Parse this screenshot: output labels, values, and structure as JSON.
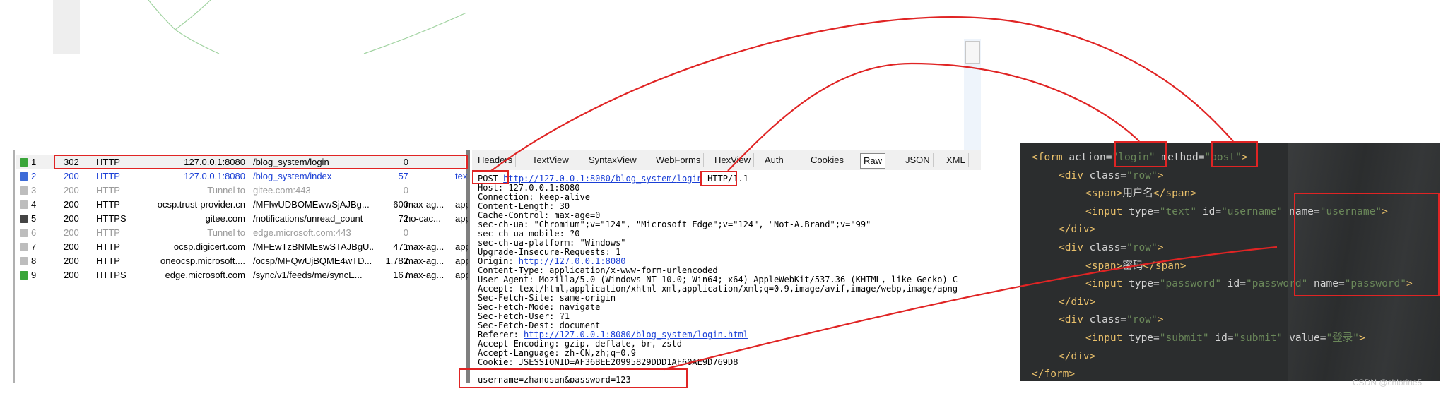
{
  "session_list": {
    "rows": [
      {
        "num": "1",
        "result": "302",
        "protocol": "HTTP",
        "host": "127.0.0.1:8080",
        "url": "/blog_system/login",
        "body": "0",
        "caching": "",
        "content_type": "",
        "icon": "arrow-right-green-icon",
        "style": "sel"
      },
      {
        "num": "2",
        "result": "200",
        "protocol": "HTTP",
        "host": "127.0.0.1:8080",
        "url": "/blog_system/index",
        "body": "57",
        "caching": "",
        "content_type": "tex",
        "icon": "bidirectional-arrow-icon",
        "style": "blue"
      },
      {
        "num": "3",
        "result": "200",
        "protocol": "HTTP",
        "host": "Tunnel to",
        "url": "gitee.com:443",
        "body": "0",
        "caching": "",
        "content_type": "",
        "icon": "lock-icon",
        "style": "gray"
      },
      {
        "num": "4",
        "result": "200",
        "protocol": "HTTP",
        "host": "ocsp.trust-provider.cn",
        "url": "/MFIwUDBOMEwwSjAJBg...",
        "body": "600",
        "caching": "max-ag...",
        "content_type": "app",
        "icon": "document-icon",
        "style": ""
      },
      {
        "num": "5",
        "result": "200",
        "protocol": "HTTPS",
        "host": "gitee.com",
        "url": "/notifications/unread_count",
        "body": "72",
        "caching": "no-cac...",
        "content_type": "app",
        "icon": "json-braces-icon",
        "style": ""
      },
      {
        "num": "6",
        "result": "200",
        "protocol": "HTTP",
        "host": "Tunnel to",
        "url": "edge.microsoft.com:443",
        "body": "0",
        "caching": "",
        "content_type": "",
        "icon": "lock-icon",
        "style": "gray"
      },
      {
        "num": "7",
        "result": "200",
        "protocol": "HTTP",
        "host": "ocsp.digicert.com",
        "url": "/MFEwTzBNMEswSTAJBgU...",
        "body": "471",
        "caching": "max-ag...",
        "content_type": "app",
        "icon": "document-icon",
        "style": ""
      },
      {
        "num": "8",
        "result": "200",
        "protocol": "HTTP",
        "host": "oneocsp.microsoft....",
        "url": "/ocsp/MFQwUjBQME4wTD...",
        "body": "1,782",
        "caching": "max-ag...",
        "content_type": "app",
        "icon": "document-icon",
        "style": ""
      },
      {
        "num": "9",
        "result": "200",
        "protocol": "HTTPS",
        "host": "edge.microsoft.com",
        "url": "/sync/v1/feeds/me/syncE...",
        "body": "167",
        "caching": "max-ag...",
        "content_type": "app",
        "icon": "arrow-right-green-icon",
        "style": ""
      }
    ]
  },
  "inspector": {
    "tabs": [
      "Headers",
      "TextView",
      "SyntaxView",
      "WebForms",
      "HexView",
      "Auth",
      "Cookies",
      "Raw",
      "JSON",
      "XML"
    ],
    "active_tab": "Raw",
    "request_line": {
      "method": "POST",
      "url_prefix": "http://127.0.0.1:8080/blog_system/",
      "url_login": "login",
      "version": " HTTP/1.1"
    },
    "headers": [
      "Host: 127.0.0.1:8080",
      "Connection: keep-alive",
      "Content-Length: 30",
      "Cache-Control: max-age=0",
      "sec-ch-ua: \"Chromium\";v=\"124\", \"Microsoft Edge\";v=\"124\", \"Not-A.Brand\";v=\"99\"",
      "sec-ch-ua-mobile: ?0",
      "sec-ch-ua-platform: \"Windows\"",
      "Upgrade-Insecure-Requests: 1"
    ],
    "origin_label": "Origin: ",
    "origin_link": "http://127.0.0.1:8080",
    "headers2": [
      "Content-Type: application/x-www-form-urlencoded",
      "User-Agent: Mozilla/5.0 (Windows NT 10.0; Win64; x64) AppleWebKit/537.36 (KHTML, like Gecko) C",
      "Accept: text/html,application/xhtml+xml,application/xml;q=0.9,image/avif,image/webp,image/apng",
      "Sec-Fetch-Site: same-origin",
      "Sec-Fetch-Mode: navigate",
      "Sec-Fetch-User: ?1",
      "Sec-Fetch-Dest: document"
    ],
    "referer_label": "Referer: ",
    "referer_link": "http://127.0.0.1:8080/blog_system/login.html",
    "headers3": [
      "Accept-Encoding: gzip, deflate, br, zstd",
      "Accept-Language: zh-CN,zh;q=0.9",
      "Cookie: JSESSIONID=AF36BEE20995829DDD1AF60AE9D769D8"
    ],
    "body": "username=zhangsan&password=123"
  },
  "code": {
    "lines": [
      [
        [
          "tg",
          "<form "
        ],
        [
          "at",
          "action="
        ],
        [
          "vl",
          "\"login\""
        ],
        [
          "at",
          " method="
        ],
        [
          "vl",
          "\"post\""
        ],
        [
          "tg",
          ">"
        ]
      ],
      [
        [
          "tg",
          "<div "
        ],
        [
          "at",
          "class="
        ],
        [
          "vl",
          "\"row\""
        ],
        [
          "tg",
          ">"
        ]
      ],
      [
        [
          "tg",
          "<span>"
        ],
        [
          "tx",
          "用户名"
        ],
        [
          "tg",
          "</span>"
        ]
      ],
      [
        [
          "tg",
          "<input "
        ],
        [
          "at",
          "type="
        ],
        [
          "vl",
          "\"text\""
        ],
        [
          "at",
          " id="
        ],
        [
          "vl",
          "\"username\""
        ],
        [
          "at",
          " name="
        ],
        [
          "vl",
          "\"username\""
        ],
        [
          "tg",
          ">"
        ]
      ],
      [
        [
          "tg",
          "</div>"
        ]
      ],
      [
        [
          "tg",
          "<div "
        ],
        [
          "at",
          "class="
        ],
        [
          "vl",
          "\"row\""
        ],
        [
          "tg",
          ">"
        ]
      ],
      [
        [
          "tg",
          "<span>"
        ],
        [
          "tx",
          "密码"
        ],
        [
          "tg",
          "</span>"
        ]
      ],
      [
        [
          "tg",
          "<input "
        ],
        [
          "at",
          "type="
        ],
        [
          "vl",
          "\"password\""
        ],
        [
          "at",
          " id="
        ],
        [
          "vl",
          "\"password\""
        ],
        [
          "at",
          " name="
        ],
        [
          "vl",
          "\"password\""
        ],
        [
          "tg",
          ">"
        ]
      ],
      [
        [
          "tg",
          "</div>"
        ]
      ],
      [
        [
          "tg",
          "<div "
        ],
        [
          "at",
          "class="
        ],
        [
          "vl",
          "\"row\""
        ],
        [
          "tg",
          ">"
        ]
      ],
      [
        [
          "tg",
          "<input "
        ],
        [
          "at",
          "type="
        ],
        [
          "vl",
          "\"submit\""
        ],
        [
          "at",
          " id="
        ],
        [
          "vl",
          "\"submit\""
        ],
        [
          "at",
          " value="
        ],
        [
          "vl",
          "\"登录\""
        ],
        [
          "tg",
          ">"
        ]
      ],
      [
        [
          "tg",
          "</div>"
        ]
      ],
      [
        [
          "tg",
          "</form>"
        ]
      ]
    ]
  },
  "watermark": "CSDN @chlorine5",
  "colors": {
    "annotation": "#e02424",
    "code_bg": "#2b2d2e",
    "tag": "#e8bf6a",
    "value": "#6a8759",
    "link": "#1a3fd6"
  }
}
